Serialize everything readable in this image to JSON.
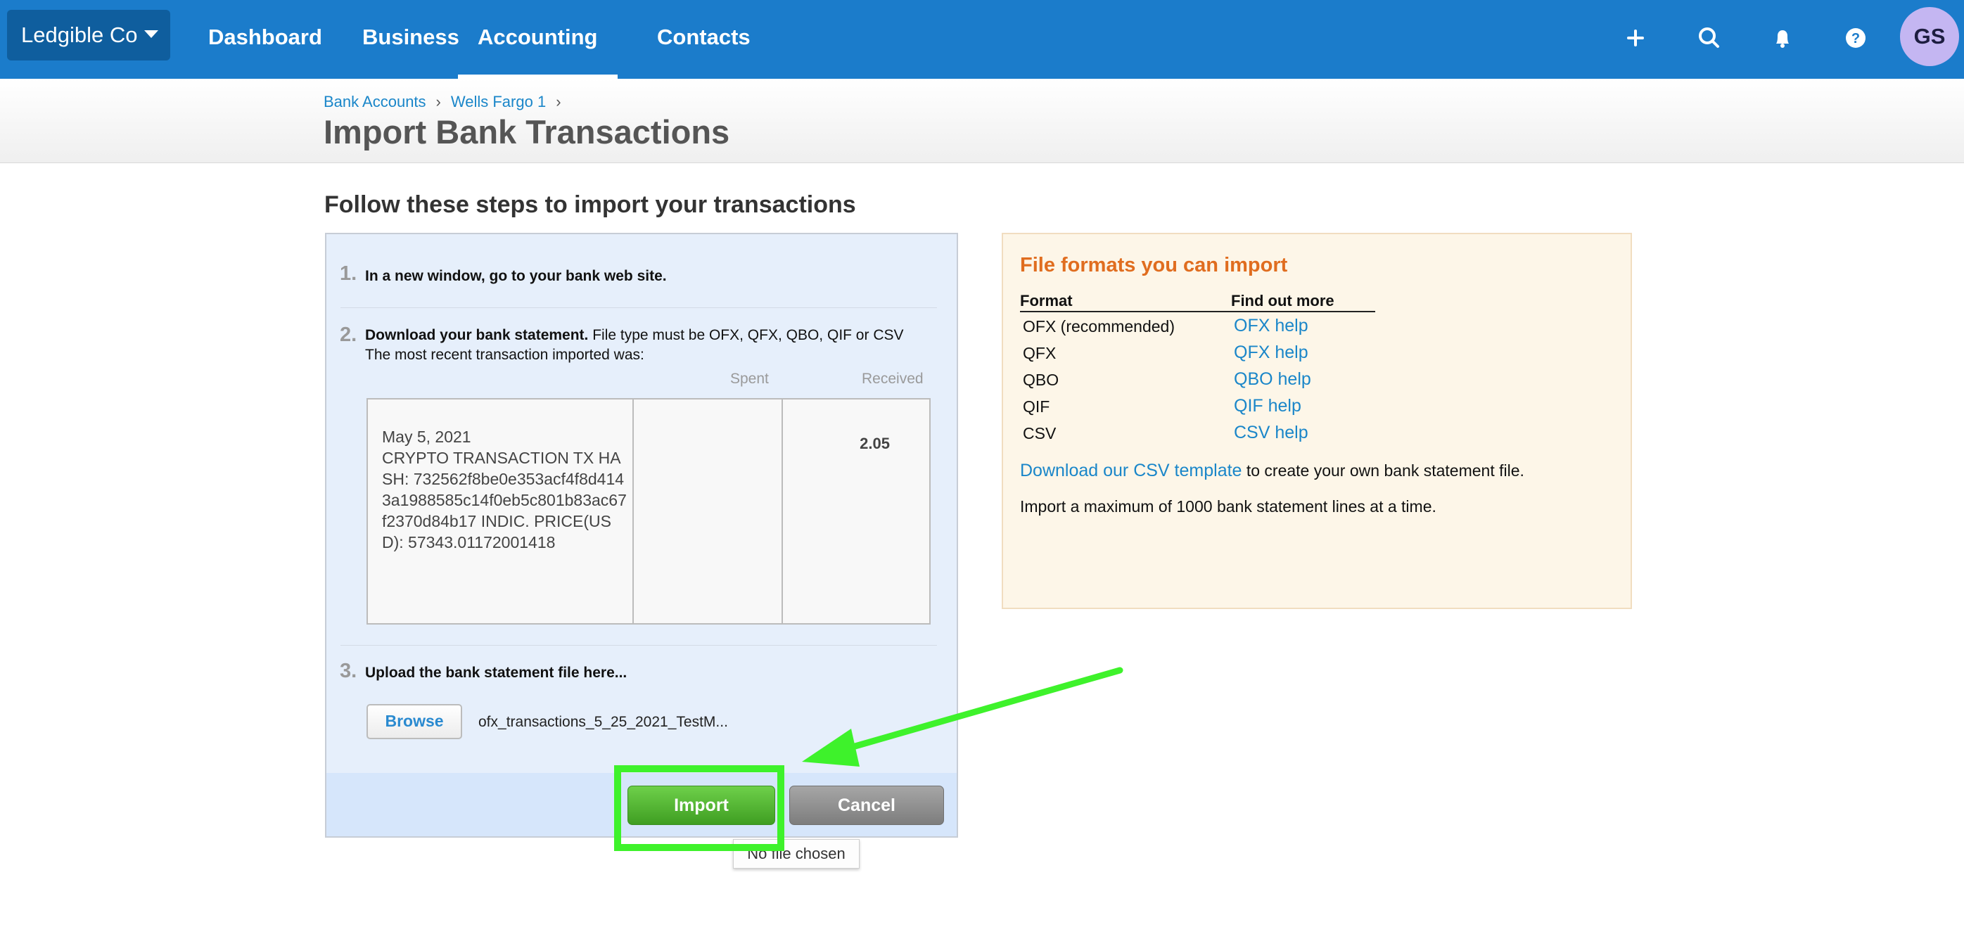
{
  "nav": {
    "org_name": "Ledgible Co",
    "items": [
      {
        "label": "Dashboard"
      },
      {
        "label": "Business"
      },
      {
        "label": "Accounting"
      },
      {
        "label": "Contacts"
      }
    ],
    "active": "Accounting",
    "icons": [
      "plus-icon",
      "search-icon",
      "bell-icon",
      "help-icon"
    ],
    "avatar_initials": "GS",
    "bar_color": "#1b7ccb"
  },
  "breadcrumb": {
    "items": [
      "Bank Accounts",
      "Wells Fargo 1"
    ],
    "separator": "›"
  },
  "page_title": "Import Bank Transactions",
  "steps_heading": "Follow these steps to import your transactions",
  "steps": {
    "step1": {
      "num": "1.",
      "text": "In a new window, go to your bank web site."
    },
    "step2": {
      "num": "2.",
      "bold_text": "Download your bank statement.",
      "text": " File type must be OFX, QFX, QBO, QIF or CSV",
      "line2": "The most recent transaction imported was:",
      "col_spent": "Spent",
      "col_received": "Received",
      "transaction": {
        "date": "May 5, 2021",
        "description": "CRYPTO TRANSACTION TX HASH: 732562f8be0e353acf4f8d4143a1988585c14f0eb5c801b83ac67f2370d84b17 INDIC. PRICE(USD): 57343.01172001418",
        "spent": "2.05",
        "received": ""
      }
    },
    "step3": {
      "num": "3.",
      "text": "Upload the bank statement file here...",
      "browse_label": "Browse",
      "file_name": "ofx_transactions_5_25_2021_TestM..."
    }
  },
  "buttons": {
    "import": "Import",
    "cancel": "Cancel"
  },
  "tooltip": "No file chosen",
  "formats": {
    "title": "File formats you can import",
    "col_format": "Format",
    "col_more": "Find out more",
    "rows": [
      {
        "name": "OFX (recommended)",
        "link": "OFX help"
      },
      {
        "name": "QFX",
        "link": "QFX help"
      },
      {
        "name": "QBO",
        "link": "QBO help"
      },
      {
        "name": "QIF",
        "link": "QIF help"
      },
      {
        "name": "CSV",
        "link": "CSV help"
      }
    ],
    "csv_link": "Download our CSV template",
    "csv_text": " to create your own bank statement file.",
    "limit_text": "Import a maximum of 1000 bank statement lines at a time."
  },
  "annotation_color": "#3ef22b"
}
